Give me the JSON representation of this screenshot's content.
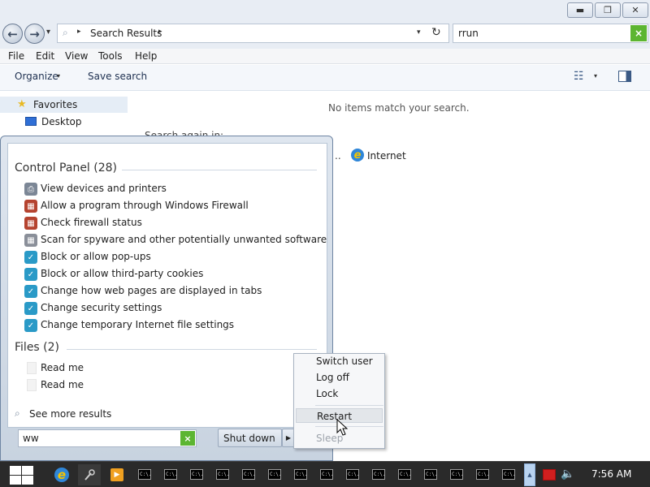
{
  "window": {
    "min_glyph": "▬",
    "max_glyph": "❐",
    "close_glyph": "✕"
  },
  "nav": {
    "back_glyph": "←",
    "forward_glyph": "→",
    "recent_glyph": "▾",
    "address_sep": "▸",
    "address_text": "Search Results",
    "dropdown_glyph": "▾",
    "refresh_glyph": "↻",
    "search_value": "rrun",
    "search_clear_glyph": "×"
  },
  "menu": [
    "File",
    "Edit",
    "View",
    "Tools",
    "Help"
  ],
  "toolbar": {
    "organize": "Organize",
    "save_search": "Save search",
    "arrow_glyph": "▾"
  },
  "navpane": {
    "favorites": "Favorites",
    "desktop": "Desktop"
  },
  "content": {
    "no_items": "No items match your search.",
    "search_again": "Search again in:",
    "internet_dots": "..",
    "internet": "Internet"
  },
  "start_menu": {
    "control_panel_title": "Control Panel (28)",
    "control_panel_items": [
      {
        "label": "View devices and printers",
        "icon": "printer-icon"
      },
      {
        "label": "Allow a program through Windows Firewall",
        "icon": "firewall-icon"
      },
      {
        "label": "Check firewall status",
        "icon": "firewall-icon"
      },
      {
        "label": "Scan for spyware and other potentially unwanted software",
        "icon": "defender-icon"
      },
      {
        "label": "Block or allow pop-ups",
        "icon": "internet-options-icon"
      },
      {
        "label": "Block or allow third-party cookies",
        "icon": "internet-options-icon"
      },
      {
        "label": "Change how web pages are displayed in tabs",
        "icon": "internet-options-icon"
      },
      {
        "label": "Change security settings",
        "icon": "internet-options-icon"
      },
      {
        "label": "Change temporary Internet file settings",
        "icon": "internet-options-icon"
      }
    ],
    "files_title": "Files (2)",
    "files": [
      "Read me",
      "Read me"
    ],
    "see_more": "See more results",
    "search_value": "ww",
    "search_clear_glyph": "×",
    "shutdown_label": "Shut down",
    "shutdown_arrow_glyph": "▶"
  },
  "power_menu": {
    "switch_user": "Switch user",
    "log_off": "Log off",
    "lock": "Lock",
    "restart": "Restart",
    "sleep": "Sleep"
  },
  "taskbar": {
    "cmd_glyph": "C:\\.",
    "scroll_glyph": "▲",
    "speaker_glyph": "🔈",
    "clock": "7:56 AM"
  },
  "colors": {
    "accent_green": "#5cb531",
    "taskbar": "#2a2a2a"
  }
}
